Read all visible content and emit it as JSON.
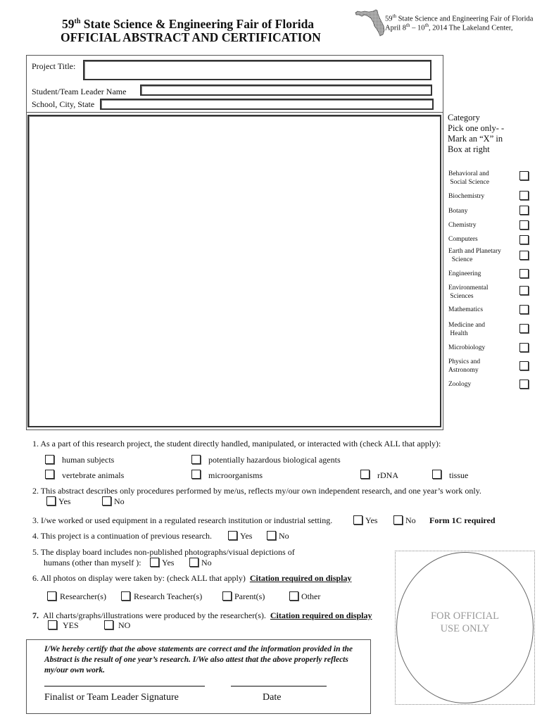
{
  "header": {
    "title_number": "59",
    "title_sup": "th",
    "title_rest": " State Science & Engineering Fair of Florida",
    "subtitle": "OFFICIAL ABSTRACT AND CERTIFICATION",
    "right_line1_num": "59",
    "right_line1_sup": "th",
    "right_line1_rest": " State Science and Engineering Fair of Florida",
    "right_line2_a": "April 8",
    "right_line2_sup1": "th",
    "right_line2_b": " – 10",
    "right_line2_sup2": "th",
    "right_line2_c": ", 2014  The Lakeland Center,",
    "logo_icon": "florida-map-icon"
  },
  "form": {
    "project_title_label": "Project Title:",
    "project_title_value": "",
    "student_name_label": "Student/Team Leader Name",
    "student_name_value": "",
    "school_label": "School, City, State",
    "school_value": "",
    "abstract_value": ""
  },
  "category": {
    "heading_lines": [
      "Category",
      "Pick one only- -",
      "Mark an “X” in",
      "Box at right"
    ],
    "items": [
      {
        "label_lines": [
          "Behavioral and",
          " Social Science"
        ],
        "checked": false
      },
      {
        "label_lines": [
          "Biochemistry"
        ],
        "checked": false
      },
      {
        "label_lines": [
          "Botany"
        ],
        "checked": false
      },
      {
        "label_lines": [
          "Chemistry"
        ],
        "checked": false
      },
      {
        "label_lines": [
          "Computers"
        ],
        "checked": false
      },
      {
        "label_lines": [
          "Earth and Planetary",
          "  Science"
        ],
        "checked": false
      },
      {
        "label_lines": [
          "Engineering"
        ],
        "checked": false
      },
      {
        "label_lines": [
          "Environmental",
          " Sciences"
        ],
        "checked": false
      },
      {
        "label_lines": [
          "Mathematics"
        ],
        "checked": false
      },
      {
        "label_lines": [
          "Medicine and",
          " Health"
        ],
        "checked": false
      },
      {
        "label_lines": [
          "Microbiology"
        ],
        "checked": false
      },
      {
        "label_lines": [
          "Physics and",
          "Astronomy"
        ],
        "checked": false
      },
      {
        "label_lines": [
          "Zoology"
        ],
        "checked": false
      }
    ]
  },
  "questions": {
    "q1": {
      "text": "1.  As a part of this research project, the student directly handled, manipulated, or interacted with (check ALL that apply):",
      "options": [
        "human subjects",
        "potentially hazardous biological agents",
        "vertebrate animals",
        "microorganisms",
        "rDNA",
        "tissue"
      ]
    },
    "q2": {
      "text": "2.  This abstract describes only procedures performed by me/us, reflects my/our own independent research, and one year’s work only.",
      "yes": "Yes",
      "no": "No"
    },
    "q3": {
      "text": "3.  I/we worked or used equipment in a regulated research institution or industrial setting.",
      "yes": "Yes",
      "no": "No",
      "note": "Form 1C required"
    },
    "q4": {
      "text": "4.  This project is a continuation of previous research.",
      "yes": "Yes",
      "no": "No"
    },
    "q5": {
      "text_line1": "5.  The display board includes non-published photographs/visual depictions of",
      "text_line2": "humans (other than myself ):",
      "yes": "Yes",
      "no": "No"
    },
    "q6": {
      "text": "6.   All photos on display were taken by: (check ALL that apply)",
      "citation": "Citation required on display",
      "options": [
        "Researcher(s)",
        "Research Teacher(s)",
        "Parent(s)",
        "Other"
      ]
    },
    "q7": {
      "number": "7.",
      "text": "All charts/graphs/illustrations were produced by the researcher(s).",
      "citation": "Citation required on display",
      "yes": "YES",
      "no": "NO"
    }
  },
  "official": {
    "line1": "FOR OFFICIAL",
    "line2": "USE ONLY"
  },
  "certification": {
    "text": "I/We hereby certify that the above statements are correct and the information provided in the Abstract is the result of one year’s research.  I/We also attest that the above properly reflects my/our own work.",
    "signature_label": "Finalist or Team Leader Signature",
    "date_label": "Date"
  }
}
